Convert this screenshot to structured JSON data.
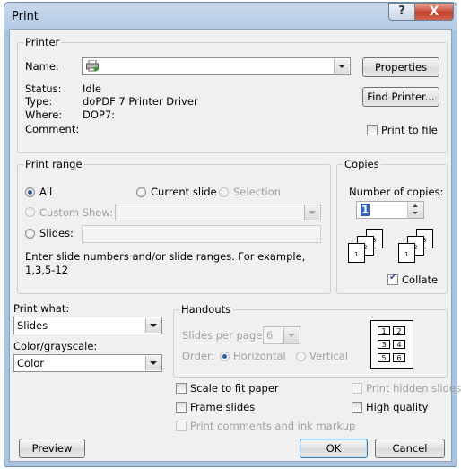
{
  "title": "Print",
  "help_glyph": "?",
  "close_glyph": "X",
  "printer": {
    "group_label": "Printer",
    "name_label": "Name:",
    "name_value": "",
    "status_label": "Status:",
    "status_value": "Idle",
    "type_label": "Type:",
    "type_value": "doPDF 7 Printer Driver",
    "where_label": "Where:",
    "where_value": "DOP7:",
    "comment_label": "Comment:",
    "properties": "Properties",
    "find_printer": "Find Printer...",
    "print_to_file": "Print to file"
  },
  "range": {
    "group_label": "Print range",
    "all": "All",
    "current_slide": "Current slide",
    "selection": "Selection",
    "custom_show": "Custom Show:",
    "slides": "Slides:",
    "hint_line1": "Enter slide numbers and/or slide ranges. For example,",
    "hint_line2": "1,3,5-12"
  },
  "copies": {
    "group_label": "Copies",
    "number_label": "Number of copies:",
    "number_value": "1",
    "collate": "Collate",
    "page_numbers": [
      "1",
      "2",
      "3"
    ]
  },
  "print_what": {
    "label": "Print what:",
    "value": "Slides"
  },
  "color": {
    "label": "Color/grayscale:",
    "value": "Color"
  },
  "handouts": {
    "group_label": "Handouts",
    "slides_per_page_label": "Slides per page:",
    "slides_per_page_value": "6",
    "order_label": "Order:",
    "horizontal": "Horizontal",
    "vertical": "Vertical",
    "preview_numbers": [
      "1",
      "2",
      "3",
      "4",
      "5",
      "6"
    ]
  },
  "options": {
    "scale": "Scale to fit paper",
    "frame": "Frame slides",
    "comments": "Print comments and ink markup",
    "hidden": "Print hidden slides",
    "high_quality": "High quality"
  },
  "buttons": {
    "preview": "Preview",
    "ok": "OK",
    "cancel": "Cancel"
  }
}
